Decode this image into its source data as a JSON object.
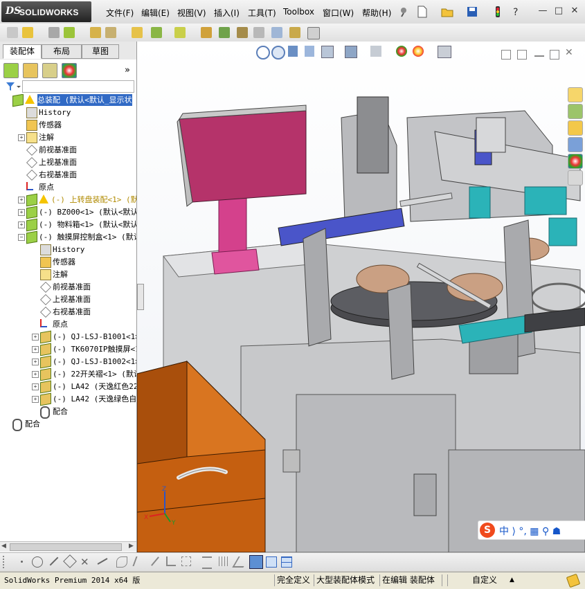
{
  "app": {
    "logo_ds": "DS",
    "logo_name": "SOLIDWORKS"
  },
  "menu": {
    "items": [
      "文件(F)",
      "编辑(E)",
      "视图(V)",
      "插入(I)",
      "工具(T)",
      "Toolbox",
      "窗口(W)",
      "帮助(H)"
    ]
  },
  "window_controls": {
    "minimize": "—",
    "restore": "□",
    "close": "✕"
  },
  "left_panel": {
    "tabs": [
      "装配体",
      "布局",
      "草图"
    ],
    "expand_glyph": "»"
  },
  "tree": {
    "nodes": [
      {
        "label": "总装配 (默认<默认_显示状",
        "indent": 0,
        "type": "assembly",
        "selected": true,
        "warning": true
      },
      {
        "label": "History",
        "indent": 1,
        "type": "history"
      },
      {
        "label": "传感器",
        "indent": 1,
        "type": "sensor"
      },
      {
        "label": "注解",
        "indent": 1,
        "type": "annotation",
        "expand": "+"
      },
      {
        "label": "前视基准面",
        "indent": 1,
        "type": "plane"
      },
      {
        "label": "上视基准面",
        "indent": 1,
        "type": "plane"
      },
      {
        "label": "右视基准面",
        "indent": 1,
        "type": "plane"
      },
      {
        "label": "原点",
        "indent": 1,
        "type": "origin"
      },
      {
        "label": "(-) 上转盘装配<1> (默认",
        "indent": 1,
        "type": "subassembly",
        "warning": true,
        "expand": "+",
        "color": "#b08a00"
      },
      {
        "label": "(-) BZ000<1> (默认<默认_显",
        "indent": 1,
        "type": "subassembly",
        "expand": "+"
      },
      {
        "label": "(-) 物料箱<1> (默认<默认_显",
        "indent": 1,
        "type": "subassembly",
        "expand": "+"
      },
      {
        "label": "(-) 触摸屏控制盒<1> (默认",
        "indent": 1,
        "type": "subassembly",
        "expand": "−"
      },
      {
        "label": "History",
        "indent": 2,
        "type": "history"
      },
      {
        "label": "传感器",
        "indent": 2,
        "type": "sensor"
      },
      {
        "label": "注解",
        "indent": 2,
        "type": "annotation"
      },
      {
        "label": "前视基准面",
        "indent": 2,
        "type": "plane"
      },
      {
        "label": "上视基准面",
        "indent": 2,
        "type": "plane"
      },
      {
        "label": "右视基准面",
        "indent": 2,
        "type": "plane"
      },
      {
        "label": "原点",
        "indent": 2,
        "type": "origin"
      },
      {
        "label": "(-) QJ-LSJ-B1001<1> (",
        "indent": 2,
        "type": "part",
        "expand": "+"
      },
      {
        "label": "(-) TK6070IP触摸屏<1>",
        "indent": 2,
        "type": "part",
        "expand": "+"
      },
      {
        "label": "(-) QJ-LSJ-B1002<1> (",
        "indent": 2,
        "type": "part",
        "expand": "+"
      },
      {
        "label": "(-) 22开关褶<1> (默认<",
        "indent": 2,
        "type": "part",
        "expand": "+"
      },
      {
        "label": "(-) LA42 (天逸红色22急",
        "indent": 2,
        "type": "part",
        "expand": "+"
      },
      {
        "label": "(-) LA42 (天逸绿色自复",
        "indent": 2,
        "type": "part",
        "expand": "+"
      },
      {
        "label": "配合",
        "indent": 2,
        "type": "mates"
      },
      {
        "label": "配合",
        "indent": 0,
        "type": "mates"
      }
    ]
  },
  "ime": {
    "logo": "S",
    "text": "中 ⟩ °, ▦ ⚲ ☗"
  },
  "axes": {
    "x": "X",
    "y": "Y",
    "z": "Z"
  },
  "status": {
    "version": "SolidWorks Premium 2014 x64 版",
    "definition": "完全定义",
    "mode": "大型装配体模式",
    "editing": "在编辑 装配体",
    "units": "自定义",
    "units_arrow": "▲"
  },
  "colors": {
    "accent": "#1556c9",
    "selection": "#316ac5",
    "warning": "#f5c400",
    "magenta": "#b5336a",
    "orange": "#c86a14",
    "cyan": "#2bb3b8",
    "blue": "#4a55c9"
  }
}
